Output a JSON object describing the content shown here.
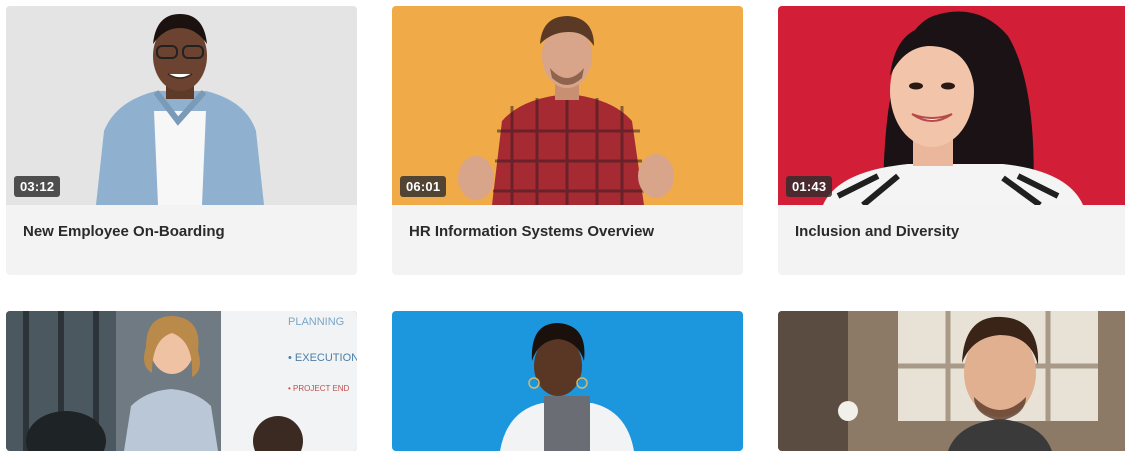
{
  "videos": [
    {
      "title": "New Employee On-Boarding",
      "duration": "03:12",
      "thumbnail_bg": "#e4e4e4"
    },
    {
      "title": "HR Information Systems Overview",
      "duration": "06:01",
      "thumbnail_bg": "#f0ab48"
    },
    {
      "title": "Inclusion and Diversity",
      "duration": "01:43",
      "thumbnail_bg": "#d21f37"
    },
    {
      "title": "",
      "duration": "",
      "thumbnail_bg": "#6f7a82"
    },
    {
      "title": "",
      "duration": "",
      "thumbnail_bg": "#1c97de"
    },
    {
      "title": "",
      "duration": "",
      "thumbnail_bg": "#8c7a66"
    }
  ],
  "whiteboard_text": [
    "PLANNING",
    "• EXECUTION",
    "• PROJECT END"
  ]
}
